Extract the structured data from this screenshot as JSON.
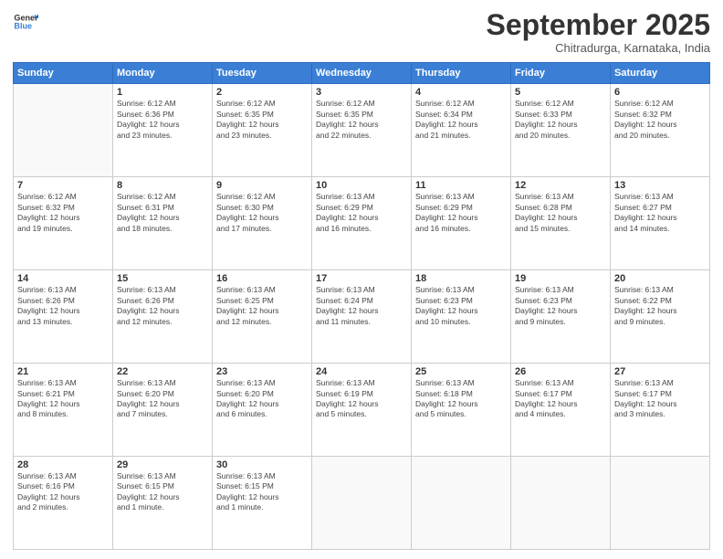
{
  "logo": {
    "line1": "General",
    "line2": "Blue"
  },
  "header": {
    "month": "September 2025",
    "location": "Chitradurga, Karnataka, India"
  },
  "days_of_week": [
    "Sunday",
    "Monday",
    "Tuesday",
    "Wednesday",
    "Thursday",
    "Friday",
    "Saturday"
  ],
  "weeks": [
    [
      {
        "day": "",
        "info": ""
      },
      {
        "day": "1",
        "info": "Sunrise: 6:12 AM\nSunset: 6:36 PM\nDaylight: 12 hours\nand 23 minutes."
      },
      {
        "day": "2",
        "info": "Sunrise: 6:12 AM\nSunset: 6:35 PM\nDaylight: 12 hours\nand 23 minutes."
      },
      {
        "day": "3",
        "info": "Sunrise: 6:12 AM\nSunset: 6:35 PM\nDaylight: 12 hours\nand 22 minutes."
      },
      {
        "day": "4",
        "info": "Sunrise: 6:12 AM\nSunset: 6:34 PM\nDaylight: 12 hours\nand 21 minutes."
      },
      {
        "day": "5",
        "info": "Sunrise: 6:12 AM\nSunset: 6:33 PM\nDaylight: 12 hours\nand 20 minutes."
      },
      {
        "day": "6",
        "info": "Sunrise: 6:12 AM\nSunset: 6:32 PM\nDaylight: 12 hours\nand 20 minutes."
      }
    ],
    [
      {
        "day": "7",
        "info": "Sunrise: 6:12 AM\nSunset: 6:32 PM\nDaylight: 12 hours\nand 19 minutes."
      },
      {
        "day": "8",
        "info": "Sunrise: 6:12 AM\nSunset: 6:31 PM\nDaylight: 12 hours\nand 18 minutes."
      },
      {
        "day": "9",
        "info": "Sunrise: 6:12 AM\nSunset: 6:30 PM\nDaylight: 12 hours\nand 17 minutes."
      },
      {
        "day": "10",
        "info": "Sunrise: 6:13 AM\nSunset: 6:29 PM\nDaylight: 12 hours\nand 16 minutes."
      },
      {
        "day": "11",
        "info": "Sunrise: 6:13 AM\nSunset: 6:29 PM\nDaylight: 12 hours\nand 16 minutes."
      },
      {
        "day": "12",
        "info": "Sunrise: 6:13 AM\nSunset: 6:28 PM\nDaylight: 12 hours\nand 15 minutes."
      },
      {
        "day": "13",
        "info": "Sunrise: 6:13 AM\nSunset: 6:27 PM\nDaylight: 12 hours\nand 14 minutes."
      }
    ],
    [
      {
        "day": "14",
        "info": "Sunrise: 6:13 AM\nSunset: 6:26 PM\nDaylight: 12 hours\nand 13 minutes."
      },
      {
        "day": "15",
        "info": "Sunrise: 6:13 AM\nSunset: 6:26 PM\nDaylight: 12 hours\nand 12 minutes."
      },
      {
        "day": "16",
        "info": "Sunrise: 6:13 AM\nSunset: 6:25 PM\nDaylight: 12 hours\nand 12 minutes."
      },
      {
        "day": "17",
        "info": "Sunrise: 6:13 AM\nSunset: 6:24 PM\nDaylight: 12 hours\nand 11 minutes."
      },
      {
        "day": "18",
        "info": "Sunrise: 6:13 AM\nSunset: 6:23 PM\nDaylight: 12 hours\nand 10 minutes."
      },
      {
        "day": "19",
        "info": "Sunrise: 6:13 AM\nSunset: 6:23 PM\nDaylight: 12 hours\nand 9 minutes."
      },
      {
        "day": "20",
        "info": "Sunrise: 6:13 AM\nSunset: 6:22 PM\nDaylight: 12 hours\nand 9 minutes."
      }
    ],
    [
      {
        "day": "21",
        "info": "Sunrise: 6:13 AM\nSunset: 6:21 PM\nDaylight: 12 hours\nand 8 minutes."
      },
      {
        "day": "22",
        "info": "Sunrise: 6:13 AM\nSunset: 6:20 PM\nDaylight: 12 hours\nand 7 minutes."
      },
      {
        "day": "23",
        "info": "Sunrise: 6:13 AM\nSunset: 6:20 PM\nDaylight: 12 hours\nand 6 minutes."
      },
      {
        "day": "24",
        "info": "Sunrise: 6:13 AM\nSunset: 6:19 PM\nDaylight: 12 hours\nand 5 minutes."
      },
      {
        "day": "25",
        "info": "Sunrise: 6:13 AM\nSunset: 6:18 PM\nDaylight: 12 hours\nand 5 minutes."
      },
      {
        "day": "26",
        "info": "Sunrise: 6:13 AM\nSunset: 6:17 PM\nDaylight: 12 hours\nand 4 minutes."
      },
      {
        "day": "27",
        "info": "Sunrise: 6:13 AM\nSunset: 6:17 PM\nDaylight: 12 hours\nand 3 minutes."
      }
    ],
    [
      {
        "day": "28",
        "info": "Sunrise: 6:13 AM\nSunset: 6:16 PM\nDaylight: 12 hours\nand 2 minutes."
      },
      {
        "day": "29",
        "info": "Sunrise: 6:13 AM\nSunset: 6:15 PM\nDaylight: 12 hours\nand 1 minute."
      },
      {
        "day": "30",
        "info": "Sunrise: 6:13 AM\nSunset: 6:15 PM\nDaylight: 12 hours\nand 1 minute."
      },
      {
        "day": "",
        "info": ""
      },
      {
        "day": "",
        "info": ""
      },
      {
        "day": "",
        "info": ""
      },
      {
        "day": "",
        "info": ""
      }
    ]
  ]
}
